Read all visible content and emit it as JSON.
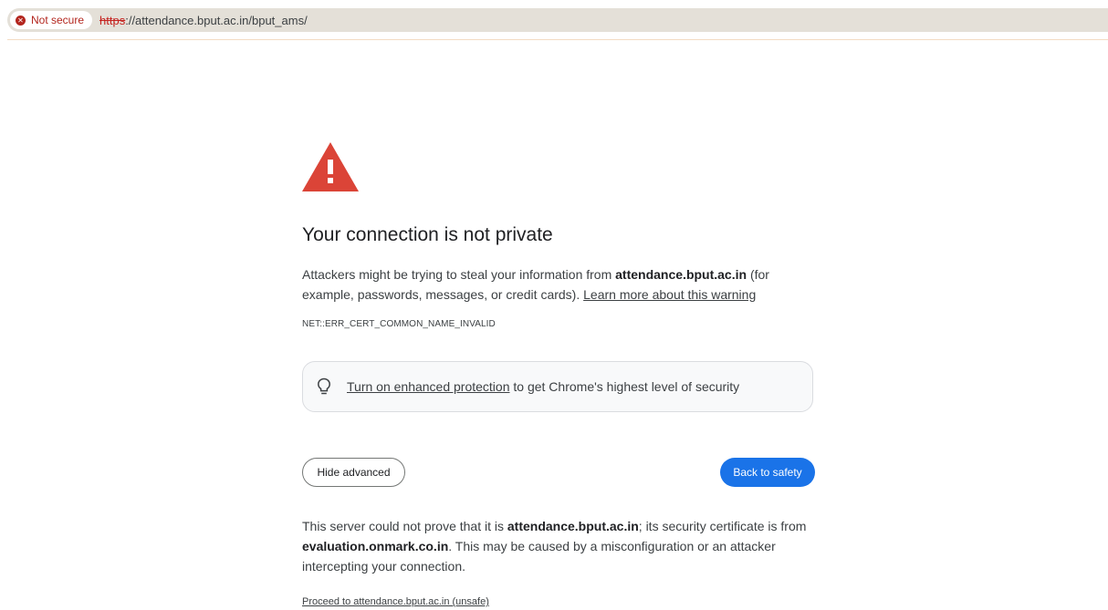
{
  "browser": {
    "security_chip": "Not secure",
    "url_scheme": "https",
    "url_rest": "://attendance.bput.ac.in/bput_ams/"
  },
  "interstitial": {
    "title": "Your connection is not private",
    "intro_before": "Attackers might be trying to steal your information from ",
    "intro_host": "attendance.bput.ac.in",
    "intro_after": " (for example, passwords, messages, or credit cards). ",
    "learn_more": "Learn more about this warning",
    "error_code": "NET::ERR_CERT_COMMON_NAME_INVALID",
    "protection_link": "Turn on enhanced protection",
    "protection_text": " to get Chrome's highest level of security",
    "hide_advanced": "Hide advanced",
    "back_to_safety": "Back to safety",
    "detail_before": "This server could not prove that it is ",
    "detail_host": "attendance.bput.ac.in",
    "detail_middle": "; its security certificate is from ",
    "detail_cert_host": "evaluation.onmark.co.in",
    "detail_after": ". This may be caused by a misconfiguration or an attacker intercepting your connection.",
    "proceed_link": "Proceed to attendance.bput.ac.in (unsafe)"
  },
  "colors": {
    "warning_red": "#db4437",
    "primary_blue": "#1a73e8",
    "insecure_red": "#b3261e"
  },
  "icons": [
    "error-circle-icon",
    "warning-triangle-icon",
    "lightbulb-icon"
  ]
}
